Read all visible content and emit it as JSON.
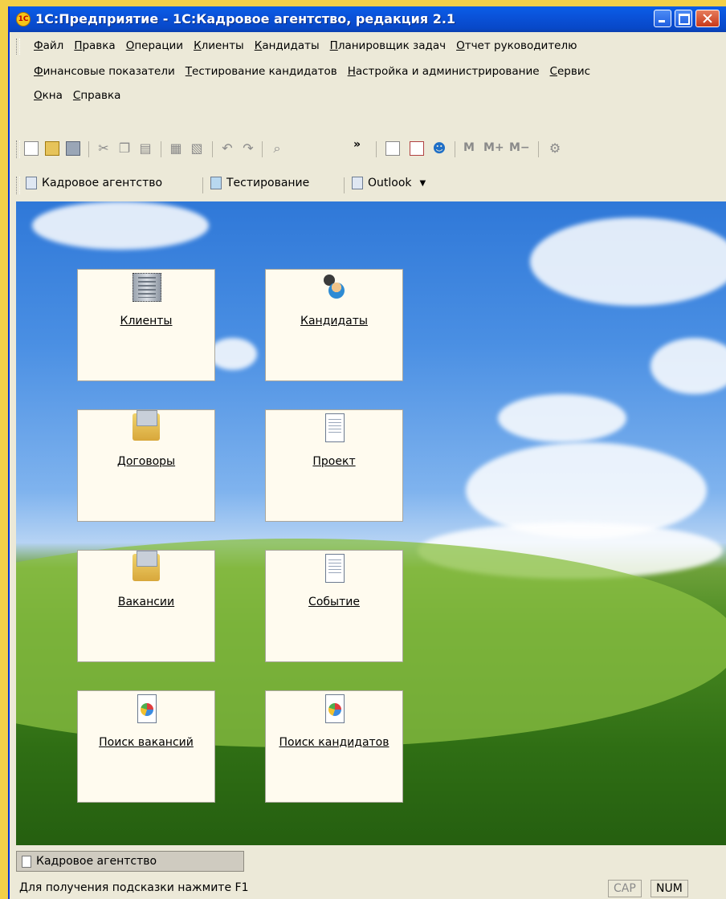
{
  "window": {
    "title": "1С:Предприятие - 1С:Кадровое агентство, редакция 2.1",
    "app_icon_text": "1С"
  },
  "menu": {
    "row1": [
      "Файл",
      "Правка",
      "Операции",
      "Клиенты",
      "Кандидаты",
      "Планировщик задач",
      "Отчет руководителю"
    ],
    "row2": [
      "Финансовые показатели",
      "Тестирование кандидатов",
      "Настройка и администрирование",
      "Сервис"
    ],
    "row3": [
      "Окна",
      "Справка"
    ]
  },
  "toolbar": {
    "m": "M",
    "m_plus": "M+",
    "m_minus": "M−",
    "more": "»"
  },
  "panels": {
    "tab1": "Кадровое агентство",
    "tab2": "Тестирование",
    "tab3": "Outlook"
  },
  "tiles": [
    {
      "label": "Клиенты",
      "icon": "building-icon"
    },
    {
      "label": "Кандидаты",
      "icon": "people-icon"
    },
    {
      "label": "Договоры",
      "icon": "box-icon"
    },
    {
      "label": "Проект",
      "icon": "document-icon"
    },
    {
      "label": "Вакансии",
      "icon": "box-icon"
    },
    {
      "label": "Событие",
      "icon": "document-icon"
    },
    {
      "label": "Поиск вакансий",
      "icon": "report-icon"
    },
    {
      "label": "Поиск кандидатов",
      "icon": "report-icon"
    }
  ],
  "window_tab": "Кадровое агентство",
  "status": {
    "hint": "Для получения подсказки нажмите F1",
    "cap": "CAP",
    "num": "NUM"
  },
  "colors": {
    "titlebar": "#0a52d9",
    "tile_bg": "#fffbef",
    "chrome": "#ece9d8"
  }
}
